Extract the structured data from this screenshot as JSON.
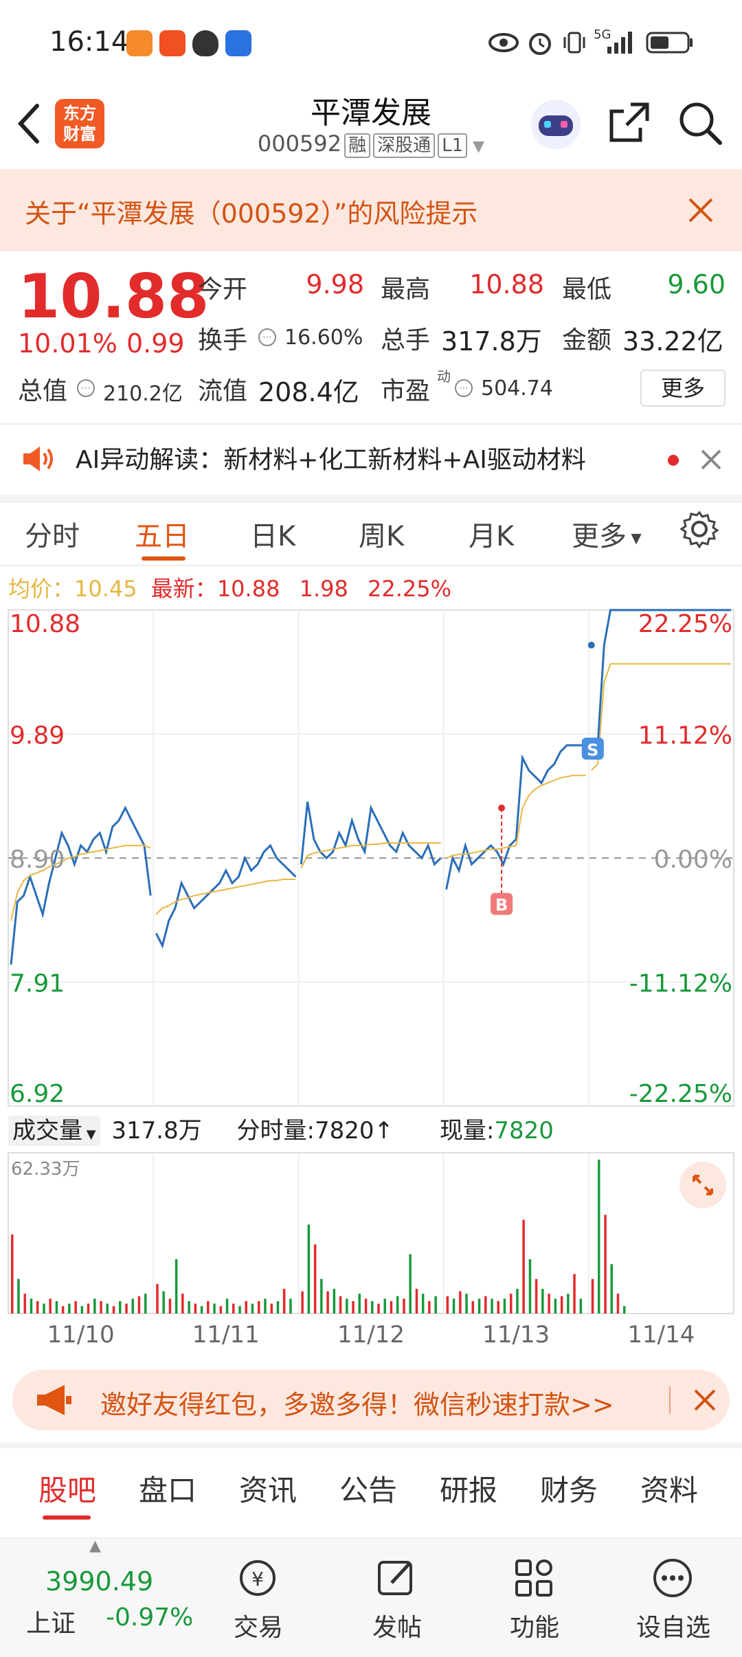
{
  "status_bar": {
    "time": "16:14",
    "network": "5G"
  },
  "header": {
    "stock_name": "平潭发展",
    "stock_code": "000592",
    "tags": [
      "融",
      "深股通",
      "L1"
    ],
    "logo_text": [
      "东方",
      "财富"
    ]
  },
  "risk_banner": {
    "text": "关于“平潭发展（000592）”的风险提示"
  },
  "quote": {
    "price": "10.88",
    "change_pct": "10.01%",
    "change": "0.99",
    "open_label": "今开",
    "open": "9.98",
    "high_label": "最高",
    "high": "10.88",
    "low_label": "最低",
    "low": "9.60",
    "turnover_label": "换手",
    "turnover": "16.60%",
    "volume_label": "总手",
    "volume": "317.8万",
    "amount_label": "金额",
    "amount": "33.22亿",
    "mktcap_label": "总值",
    "mktcap": "210.2亿",
    "float_label": "流值",
    "float_cap": "208.4亿",
    "pe_label": "市盈",
    "pe_sup": "动",
    "pe": "504.74",
    "more_button": "更多"
  },
  "ai_row": {
    "text": "AI异动解读：新材料+化工新材料+AI驱动材料"
  },
  "period_tabs": [
    {
      "label": "分时"
    },
    {
      "label": "五日"
    },
    {
      "label": "日K"
    },
    {
      "label": "周K"
    },
    {
      "label": "月K"
    },
    {
      "label": "更多"
    }
  ],
  "period_active": "五日",
  "chart_info": {
    "avg_label": "均价：",
    "avg": "10.45",
    "latest_label": "最新：",
    "latest": "10.88",
    "change": "1.98",
    "change_pct": "22.25%"
  },
  "volume_info": {
    "selector": "成交量",
    "total": "317.8万",
    "tick_label": "分时量:",
    "tick": "7820↑",
    "now_label": "现量:",
    "now": "7820"
  },
  "chart_data": [
    {
      "type": "line",
      "x": [
        "11/10",
        "11/11",
        "11/12",
        "11/13",
        "11/14"
      ],
      "y_ticks_left": [
        "10.88",
        "9.89",
        "8.90",
        "7.91",
        "6.92"
      ],
      "y_ticks_right": [
        "22.25%",
        "11.12%",
        "0.00%",
        "-11.12%",
        "-22.25%"
      ],
      "ylim": [
        6.92,
        10.88
      ],
      "baseline": 8.9,
      "markers": [
        {
          "label": "B",
          "day": "11/13"
        },
        {
          "label": "S",
          "day": "11/14"
        }
      ],
      "series": [
        {
          "values": [
            [
              8.05,
              8.55,
              8.6,
              8.75,
              8.6,
              8.45,
              8.7,
              8.9,
              9.1,
              9.0,
              8.85,
              9.0,
              8.95,
              9.05,
              9.1,
              8.95,
              9.15,
              9.2,
              9.3,
              9.2,
              9.1,
              9.0,
              8.6
            ],
            [
              8.3,
              8.2,
              8.4,
              8.5,
              8.7,
              8.6,
              8.5,
              8.55,
              8.6,
              8.65,
              8.7,
              8.8,
              8.7,
              8.75,
              8.9,
              8.8,
              8.85,
              8.95,
              9.0,
              8.9,
              8.85,
              8.8,
              8.75
            ],
            [
              8.85,
              9.35,
              9.05,
              8.95,
              8.9,
              8.95,
              9.1,
              9.0,
              9.2,
              9.05,
              8.95,
              9.3,
              9.2,
              9.1,
              9.0,
              8.95,
              9.1,
              9.0,
              8.95,
              8.9,
              9.0,
              8.85,
              8.9
            ],
            [
              8.65,
              8.9,
              8.8,
              9.0,
              8.85,
              8.9,
              8.95,
              9.0,
              8.95,
              8.85,
              9.0,
              9.05,
              9.7,
              9.6,
              9.55,
              9.5,
              9.6,
              9.65,
              9.75,
              9.8,
              9.8,
              9.8,
              9.8
            ],
            [
              9.8,
              9.8,
              10.6,
              10.88,
              10.88,
              10.88,
              10.88,
              10.88,
              10.88,
              10.88,
              10.88,
              10.88,
              10.88,
              10.88,
              10.88,
              10.88,
              10.88,
              10.88,
              10.88,
              10.88,
              10.88,
              10.88,
              10.88
            ]
          ]
        },
        {
          "values": [
            [
              8.4,
              8.62,
              8.72,
              8.76,
              8.78,
              8.8,
              8.83,
              8.85,
              8.87,
              8.9,
              8.91,
              8.93,
              8.94,
              8.95,
              8.96,
              8.97,
              8.98,
              8.99,
              9.0,
              9.0,
              9.0,
              9.0,
              8.98
            ],
            [
              8.45,
              8.5,
              8.52,
              8.55,
              8.57,
              8.58,
              8.6,
              8.61,
              8.62,
              8.63,
              8.64,
              8.65,
              8.66,
              8.67,
              8.68,
              8.69,
              8.7,
              8.71,
              8.72,
              8.72,
              8.73,
              8.73,
              8.73
            ],
            [
              8.82,
              8.92,
              8.94,
              8.95,
              8.96,
              8.97,
              8.98,
              8.99,
              9.0,
              9.0,
              9.0,
              9.01,
              9.01,
              9.02,
              9.02,
              9.02,
              9.02,
              9.02,
              9.02,
              9.02,
              9.02,
              9.02,
              9.02
            ],
            [
              8.9,
              8.92,
              8.93,
              8.93,
              8.94,
              8.95,
              8.96,
              8.97,
              8.97,
              8.98,
              8.99,
              9.0,
              9.3,
              9.4,
              9.45,
              9.48,
              9.5,
              9.52,
              9.54,
              9.55,
              9.56,
              9.56,
              9.56
            ],
            [
              9.6,
              9.65,
              10.3,
              10.45,
              10.45,
              10.45,
              10.45,
              10.45,
              10.45,
              10.45,
              10.45,
              10.45,
              10.45,
              10.45,
              10.45,
              10.45,
              10.45,
              10.45,
              10.45,
              10.45,
              10.45,
              10.45,
              10.45
            ]
          ]
        }
      ]
    },
    {
      "type": "bar",
      "ylabel": "62.33万",
      "ymax": 62.33,
      "days": [
        "11/10",
        "11/11",
        "11/12",
        "11/13",
        "11/14"
      ],
      "values": [
        [
          32,
          14,
          8,
          6,
          5,
          4,
          6,
          5,
          3,
          4,
          5,
          3,
          4,
          6,
          5,
          4,
          3,
          5,
          4,
          6,
          7,
          8
        ],
        [
          12,
          9,
          6,
          22,
          8,
          5,
          4,
          3,
          5,
          4,
          3,
          6,
          4,
          3,
          5,
          4,
          5,
          6,
          4,
          5,
          10,
          6
        ],
        [
          9,
          36,
          28,
          14,
          9,
          10,
          7,
          6,
          5,
          8,
          6,
          5,
          4,
          6,
          5,
          7,
          6,
          24,
          10,
          8,
          5,
          7
        ],
        [
          7,
          6,
          9,
          8,
          5,
          6,
          7,
          6,
          5,
          6,
          8,
          10,
          38,
          22,
          14,
          10,
          8,
          6,
          7,
          8,
          16,
          6
        ],
        [
          14,
          62.33,
          40,
          20,
          8,
          3,
          0,
          0,
          0,
          0,
          0,
          0,
          0,
          0,
          0,
          0,
          0,
          0,
          0,
          0,
          0,
          0
        ]
      ]
    }
  ],
  "promo": {
    "text": "邀好友得红包，多邀多得！微信秒速打款>>"
  },
  "bottom_tabs": [
    {
      "label": "股吧"
    },
    {
      "label": "盘口"
    },
    {
      "label": "资讯"
    },
    {
      "label": "公告"
    },
    {
      "label": "研报"
    },
    {
      "label": "财务"
    },
    {
      "label": "资料"
    }
  ],
  "bottom_nav": {
    "index_value": "3990.49",
    "index_name": "上证",
    "index_change": "-0.97%",
    "items": [
      {
        "label": "交易"
      },
      {
        "label": "发帖"
      },
      {
        "label": "功能"
      },
      {
        "label": "设自选"
      }
    ]
  },
  "colors": {
    "up": "#e22b2b",
    "down": "#17993a",
    "accent": "#e05512",
    "price_line": "#2a6eb8",
    "avg_line": "#e6b640"
  }
}
